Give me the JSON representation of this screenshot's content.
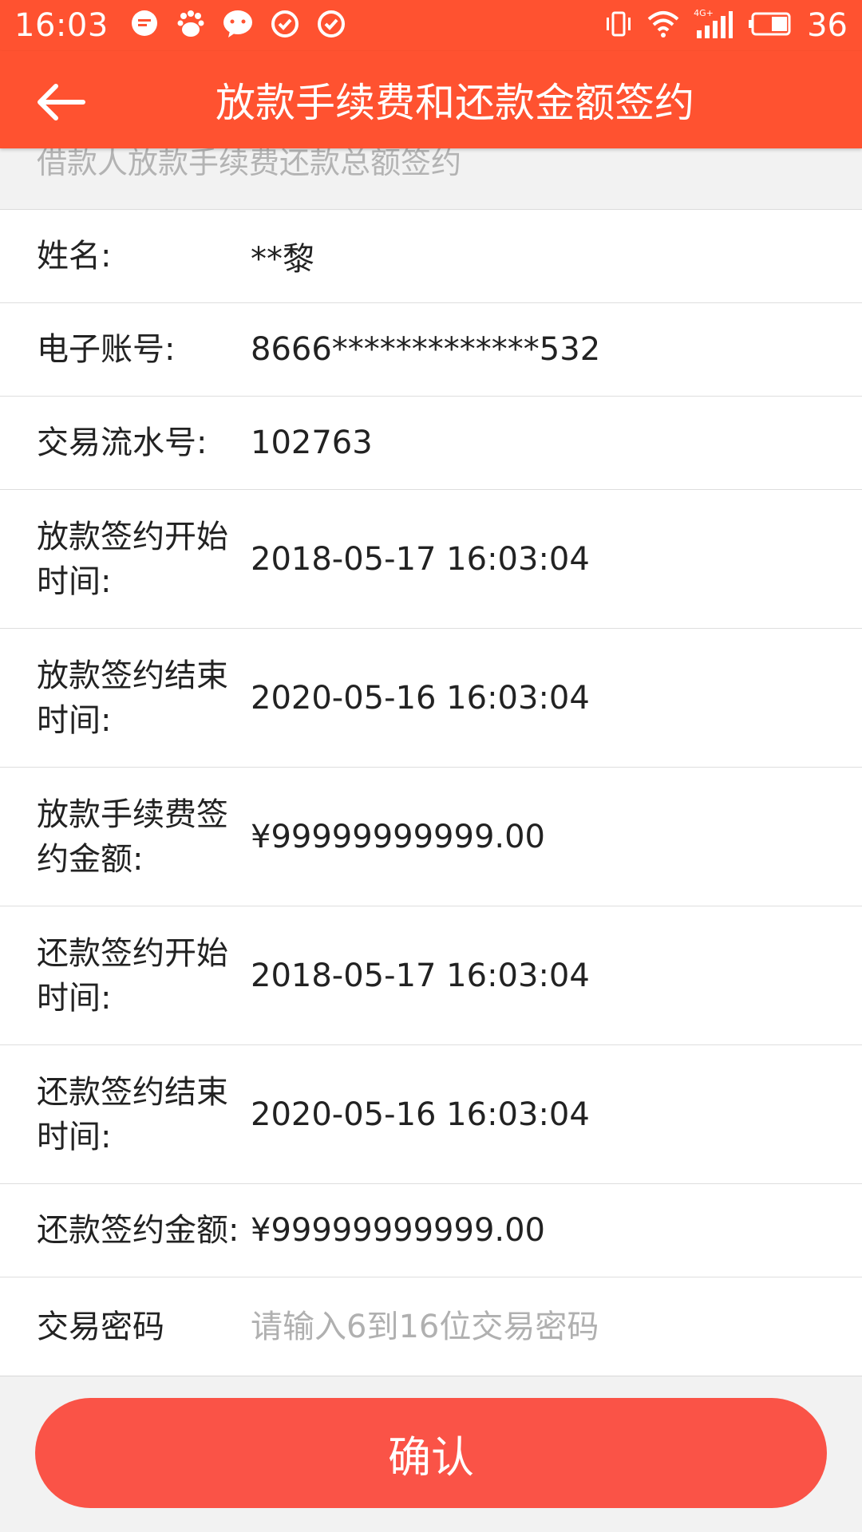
{
  "status_bar": {
    "time": "16:03",
    "battery_level": "36",
    "network_label": "4G+",
    "left_icons": [
      "chat-bubble-icon",
      "baidu-paw-icon",
      "wechat-icon",
      "check-circle-icon",
      "check-circle-icon"
    ],
    "right_icons": [
      "vibrate-icon",
      "wifi-icon",
      "signal-icon",
      "battery-icon"
    ]
  },
  "app_bar": {
    "title": "放款手续费和还款金额签约",
    "back_icon": "arrow-left-icon"
  },
  "section": {
    "header": "借款人放款手续费还款总额签约"
  },
  "fields": {
    "name": {
      "label": "姓名:",
      "value": "**黎"
    },
    "account": {
      "label": "电子账号:",
      "value": "8666*************532"
    },
    "serial": {
      "label": "交易流水号:",
      "value": "102763"
    },
    "loan_start": {
      "label": "放款签约开始时间:",
      "value": "2018-05-17 16:03:04"
    },
    "loan_end": {
      "label": "放款签约结束时间:",
      "value": "2020-05-16 16:03:04"
    },
    "fee_amount": {
      "label": "放款手续费签约金额:",
      "value": "¥99999999999.00"
    },
    "repay_start": {
      "label": "还款签约开始时间:",
      "value": "2018-05-17 16:03:04"
    },
    "repay_end": {
      "label": "还款签约结束时间:",
      "value": "2020-05-16 16:03:04"
    },
    "repay_amount": {
      "label": "还款签约金额:",
      "value": "¥99999999999.00"
    },
    "password": {
      "label": "交易密码",
      "value": "",
      "placeholder": "请输入6到16位交易密码"
    }
  },
  "confirm_button": {
    "label": "确认"
  },
  "colors": {
    "app_bar": "#ff5230",
    "button": "#fa5347",
    "page_bg": "#f2f2f2"
  }
}
